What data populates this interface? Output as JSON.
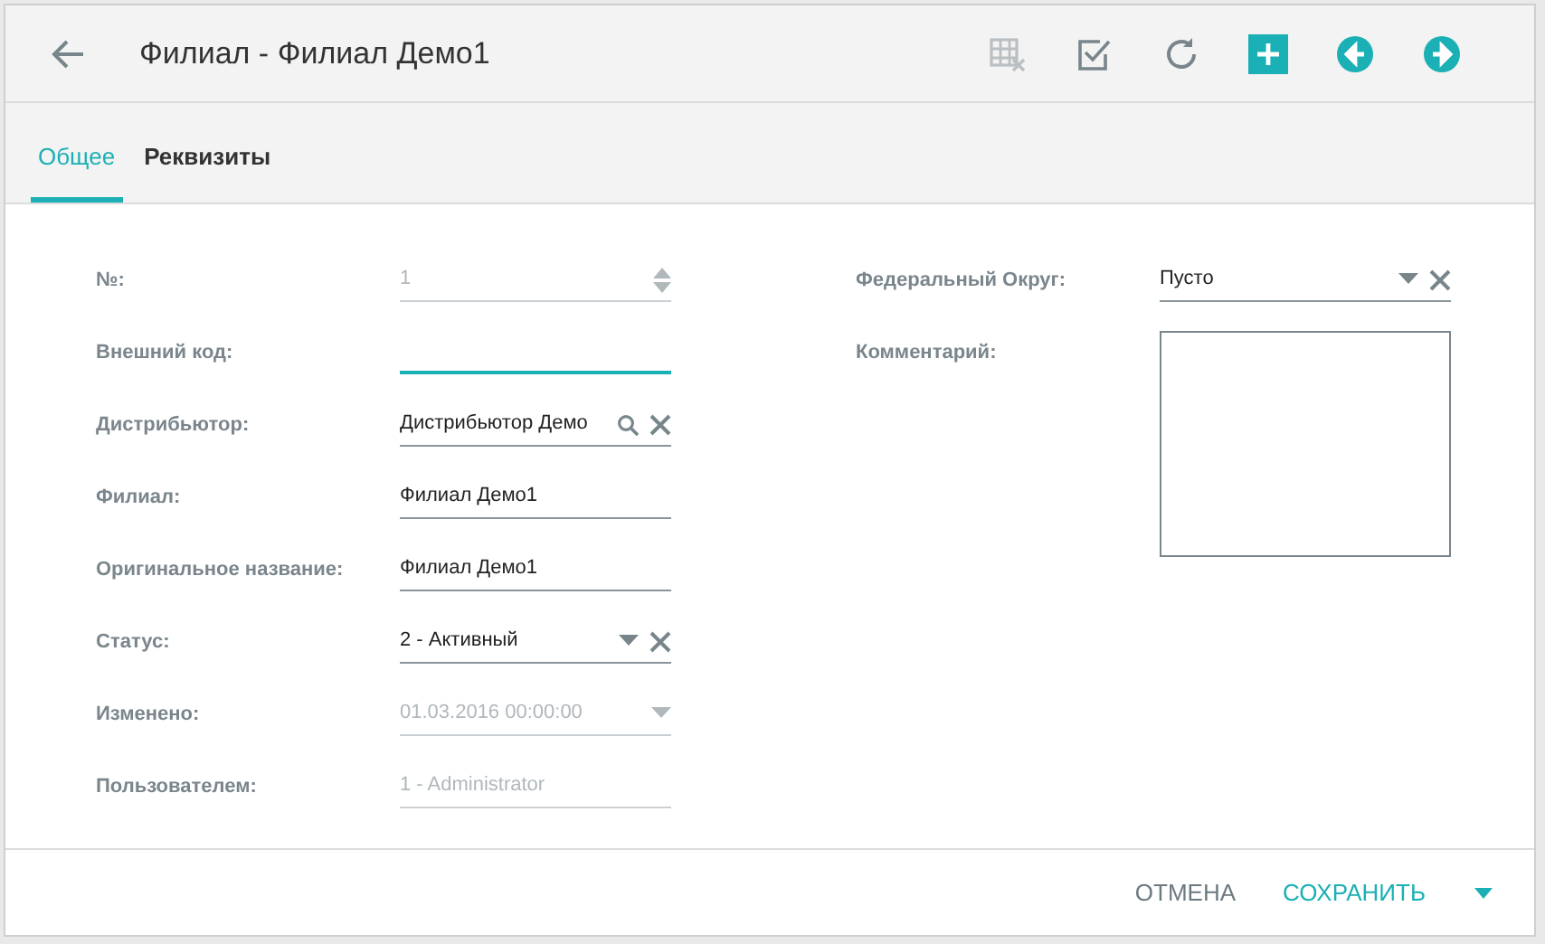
{
  "header": {
    "title": "Филиал - Филиал Демо1"
  },
  "toolbar": [
    {
      "kind": "grid-clear",
      "disabled": true
    },
    {
      "kind": "check",
      "disabled": false
    },
    {
      "kind": "refresh",
      "disabled": false
    },
    {
      "kind": "add",
      "disabled": false
    },
    {
      "kind": "prev",
      "disabled": false
    },
    {
      "kind": "next",
      "disabled": false
    }
  ],
  "tabs": [
    {
      "label": "Общее",
      "selected": true
    },
    {
      "label": "Реквизиты",
      "selected": false
    }
  ],
  "left_fields": [
    {
      "label": "№:",
      "kind": "number",
      "value": "1",
      "disabled": true,
      "focused": false
    },
    {
      "label": "Внешний код:",
      "kind": "text",
      "disabled": false,
      "focused": true
    },
    {
      "label": "Дистрибьютор:",
      "kind": "lookup",
      "value": "Дистрибьютор Демо",
      "disabled": false,
      "focused": false
    },
    {
      "label": "Филиал:",
      "kind": "text",
      "value": "Филиал Демо1",
      "disabled": false,
      "focused": false
    },
    {
      "label": "Оригинальное название:",
      "kind": "text",
      "value": "Филиал Демо1",
      "disabled": false,
      "focused": false
    },
    {
      "label": "Статус:",
      "kind": "select",
      "value": "2 - Активный",
      "disabled": false,
      "focused": false
    },
    {
      "label": "Изменено:",
      "kind": "date",
      "value": "01.03.2016 00:00:00",
      "disabled": true,
      "focused": false
    },
    {
      "label": "Пользователем:",
      "kind": "text",
      "value": "1 - Administrator",
      "disabled": true,
      "focused": false
    }
  ],
  "right_fields": [
    {
      "label": "Федеральный Округ:",
      "kind": "select",
      "value": "Пусто"
    },
    {
      "label": "Комментарий:",
      "kind": "textarea"
    }
  ],
  "footer": {
    "cancel": "ОТМЕНА",
    "save": "СОХРАНИТЬ"
  }
}
